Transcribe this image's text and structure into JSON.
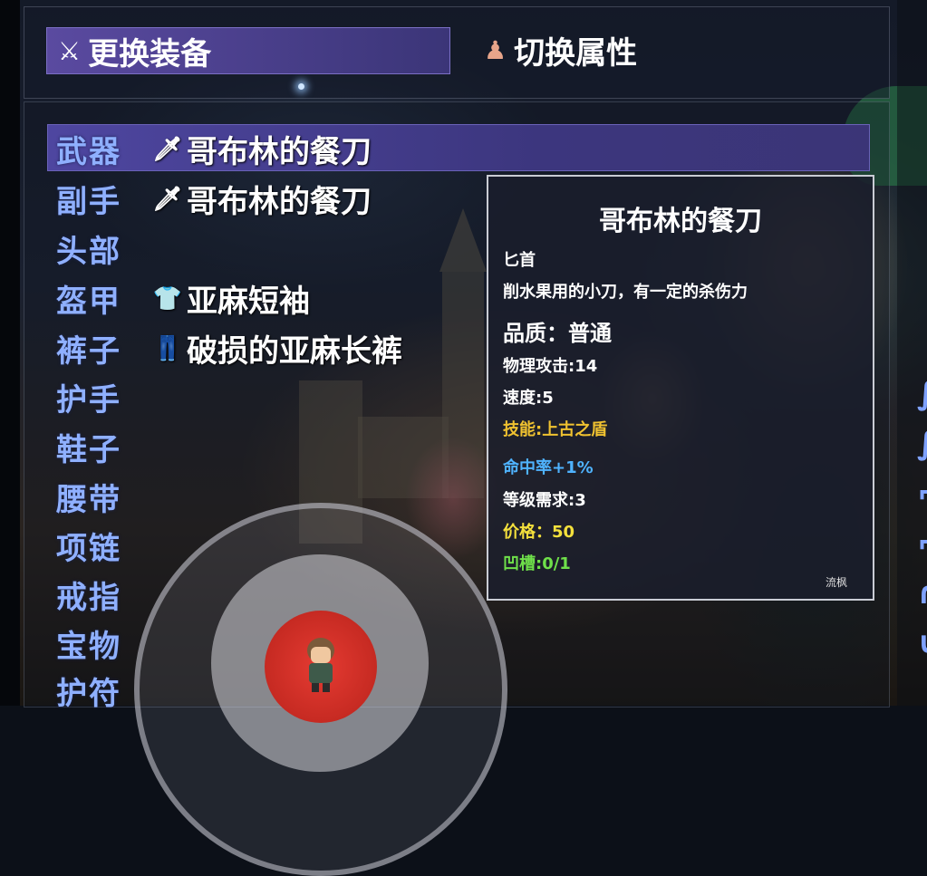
{
  "tabs": {
    "equip": {
      "icon": "armor-icon",
      "label": "更换装备"
    },
    "attr": {
      "icon": "torso-icon",
      "label": "切换属性"
    }
  },
  "slots": [
    {
      "label": "武器",
      "item": "哥布林的餐刀",
      "icon": "knife-icon",
      "selected": true
    },
    {
      "label": "副手",
      "item": "哥布林的餐刀",
      "icon": "knife-icon",
      "selected": false
    },
    {
      "label": "头部",
      "item": "",
      "icon": "",
      "selected": false
    },
    {
      "label": "盔甲",
      "item": "亚麻短袖",
      "icon": "shirt-icon",
      "selected": false
    },
    {
      "label": "裤子",
      "item": "破损的亚麻长裤",
      "icon": "pants-icon",
      "selected": false
    },
    {
      "label": "护手",
      "item": "",
      "icon": "",
      "selected": false
    },
    {
      "label": "鞋子",
      "item": "",
      "icon": "",
      "selected": false
    },
    {
      "label": "腰带",
      "item": "",
      "icon": "",
      "selected": false
    },
    {
      "label": "项链",
      "item": "",
      "icon": "",
      "selected": false
    },
    {
      "label": "戒指",
      "item": "",
      "icon": "",
      "selected": false
    },
    {
      "label": "宝物",
      "item": "",
      "icon": "",
      "selected": false
    },
    {
      "label": "护符",
      "item": "",
      "icon": "",
      "selected": false
    }
  ],
  "tooltip": {
    "title": "哥布林的餐刀",
    "type": "匕首",
    "desc": "削水果用的小刀，有一定的杀伤力",
    "quality": "品质：普通",
    "attack": "物理攻击:14",
    "speed": "速度:5",
    "skill": "技能:上古之盾",
    "hit": "命中率+1%",
    "level_req": "等级需求:3",
    "price": "价格：50",
    "slots": "凹槽:0/1",
    "signature": "流枫"
  },
  "colors": {
    "slot_label": "#8fb0ff",
    "highlight": "#4e46a0",
    "skill": "#f0c230",
    "hit": "#4fb3ff",
    "price": "#f4e03c",
    "socket": "#6fe04a",
    "joystick_knob": "#d83229"
  }
}
